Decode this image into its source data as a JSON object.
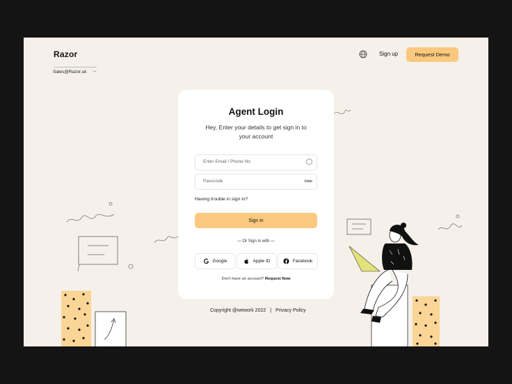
{
  "header": {
    "brand": "Razor",
    "sales_email": "Sales@Razor.uk",
    "sales_arrow": "→",
    "signup_label": "Sign up",
    "demo_label": "Request Demo"
  },
  "login": {
    "title": "Agent Login",
    "subtitle": "Hey, Enter your details to get sign in to your account",
    "email_placeholder": "Enter Email / Phone No",
    "passcode_placeholder": "Passcode",
    "hide_label": "Hide",
    "trouble_link": "Having trouble in sign in?",
    "signin_label": "Sign in",
    "or_text": "— Or Sign in with —",
    "social": {
      "google": "Google",
      "apple": "Apple ID",
      "facebook": "Facebook"
    },
    "no_account_text": "Don't have an account?",
    "request_now_link": "Request Now"
  },
  "footer": {
    "copyright": "Copyright @wework 2022",
    "separator": "|",
    "privacy": "Privacy Policy"
  },
  "colors": {
    "page_background": "#f5f0e9",
    "accent": "#fac97f",
    "outer_background": "#141414"
  }
}
